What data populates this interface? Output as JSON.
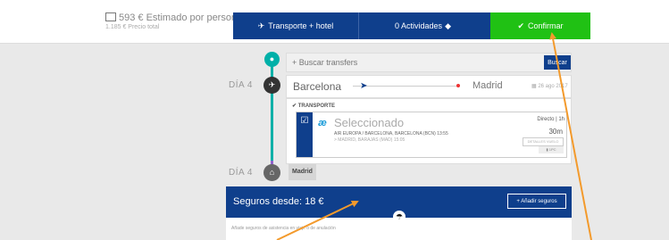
{
  "header": {
    "price_main": "593 € Estimado por persona",
    "price_sub": "1.185 € Precio total"
  },
  "tabs": [
    {
      "label": "Transporte + hotel",
      "icon": "bed-plane-icon"
    },
    {
      "label": "0 Actividades",
      "icon": "diamond-icon"
    },
    {
      "label": "Confirmar",
      "icon": "check-icon"
    }
  ],
  "itinerary": {
    "day_label_1": "DÍA 4",
    "day_label_2": "DÍA 4",
    "search_placeholder": "+ Buscar transfers",
    "search_button": "Buscar",
    "origin": "Barcelona",
    "destination": "Madrid",
    "date": "26 ago 2017",
    "transport_label": "TRANSPORTE",
    "status": "Seleccionado",
    "leg_1": "AIR EUROPA / BARCELONA, BARCELONA (BCN) 13:55",
    "leg_2": "> MADRID, BARAJAS (MAD) 15:05",
    "direct": "Directo | 1h",
    "duration": "30m",
    "details_button": "DETALLES VUELO",
    "baggage": "1PC",
    "city_badge": "Madrid"
  },
  "insurance": {
    "title": "Seguros desde: 18 €",
    "add_button": "+ Añadir seguros",
    "description": "Añade seguros de asistencia en viaje o de anulación"
  },
  "colors": {
    "brand_blue": "#0f3f8c",
    "confirm_green": "#20c114",
    "timeline_teal": "#00b0a8",
    "annotation_orange": "#f39a2c"
  }
}
